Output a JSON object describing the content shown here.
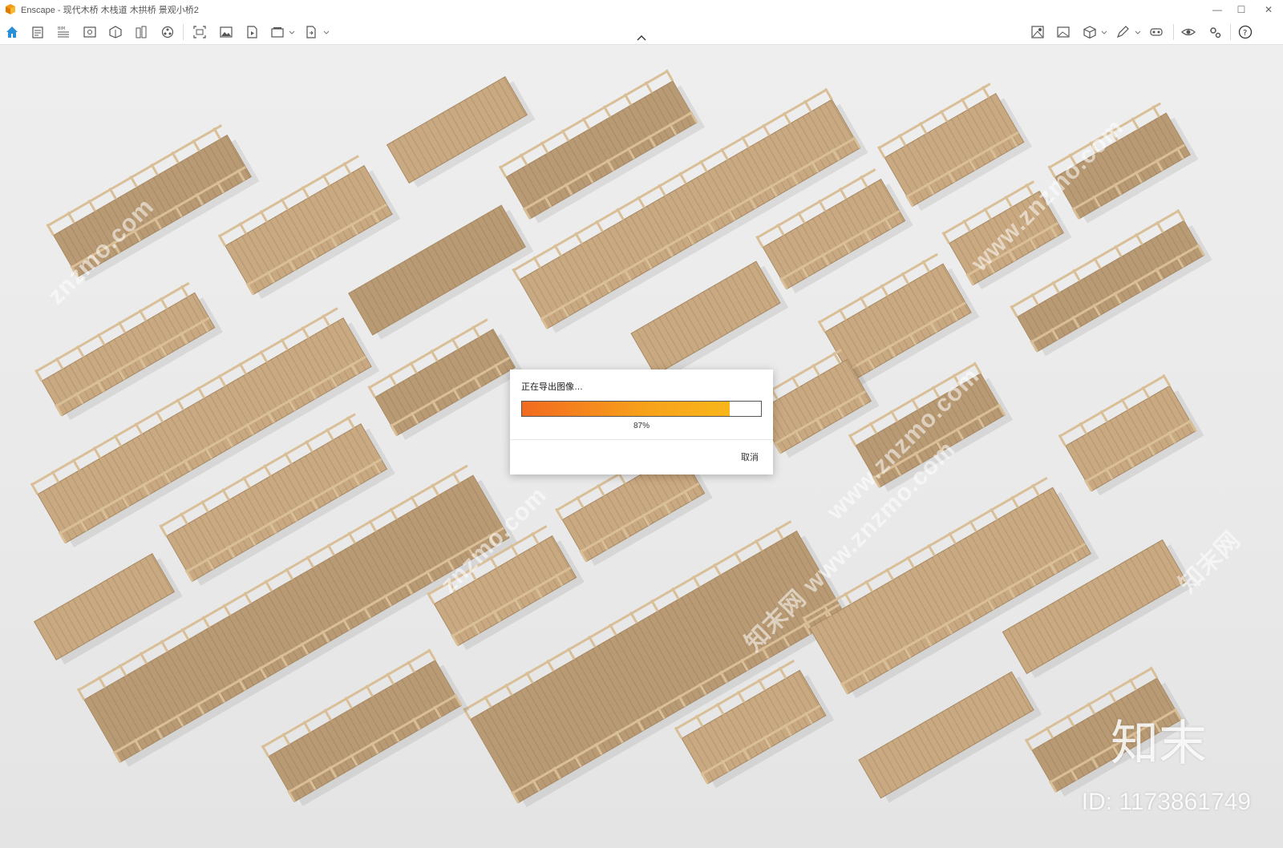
{
  "window": {
    "title": "Enscape - 现代木桥 木栈道 木拱桥 景观小桥2",
    "minimize": "—",
    "maximize": "☐",
    "close": "✕"
  },
  "toolbar": {
    "left_icons": [
      "home-icon",
      "notes-icon",
      "bim-icon",
      "view-icon",
      "materials-icon",
      "library-icon",
      "assets-icon",
      "screenshot-icon",
      "image-icon",
      "video-icon",
      "batch-render-icon",
      "export-icon"
    ],
    "right_icons": [
      "visual-settings-icon",
      "capture-icon",
      "cube-icon",
      "pen-icon",
      "vr-icon",
      "eye-icon",
      "settings-icon",
      "help-icon"
    ]
  },
  "viewport": {
    "watermarks": [
      "znzmo.com",
      "www.znzmo.com",
      "知末网",
      "知末网 www.znzmo.com"
    ],
    "brand_mark": "知末",
    "id_mark": "ID: 1173861749"
  },
  "dialog": {
    "message": "正在导出图像…",
    "progress": 87,
    "progress_label": "87%",
    "cancel_label": "取消"
  },
  "colors": {
    "accent": "#f39c12",
    "progress_start": "#f26a1f",
    "progress_end": "#f8b61a",
    "wood": "#c9a981"
  }
}
